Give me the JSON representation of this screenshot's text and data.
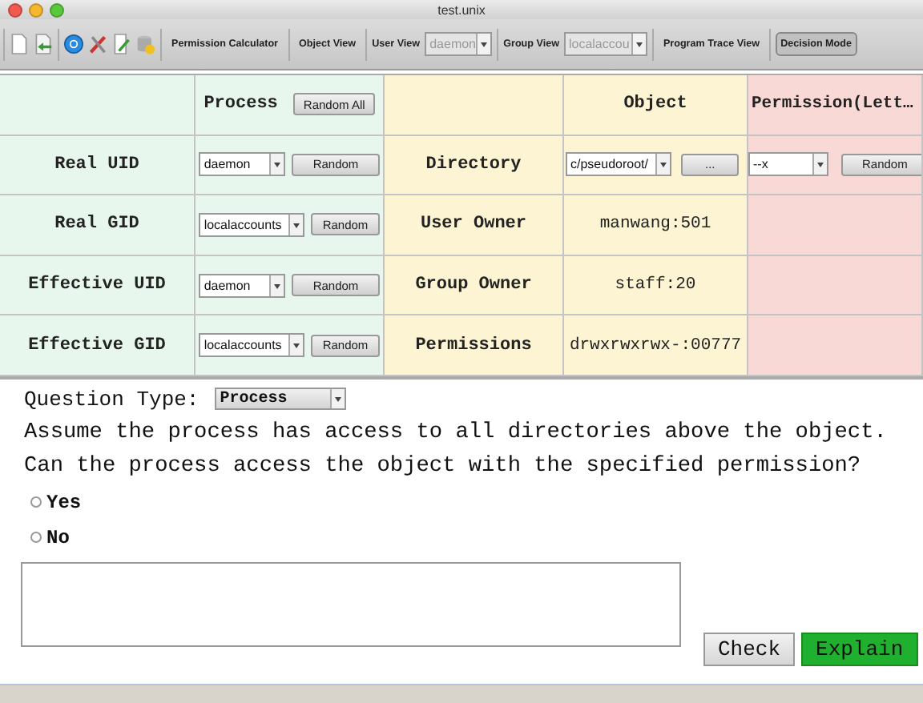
{
  "window": {
    "title": "test.unix"
  },
  "toolbar": {
    "views": [
      {
        "label": "Permission Calculator",
        "kind": "button",
        "selected": false
      },
      {
        "label": "Object View",
        "kind": "button",
        "selected": false
      },
      {
        "label": "User View",
        "kind": "combo",
        "value": "daemon",
        "disabled": true
      },
      {
        "label": "Group View",
        "kind": "combo",
        "value": "localaccou",
        "disabled": true
      },
      {
        "label": "Program Trace View",
        "kind": "button",
        "selected": false
      },
      {
        "label": "Decision Mode",
        "kind": "button",
        "selected": true
      }
    ]
  },
  "table": {
    "process_header": {
      "title": "Process",
      "button": "Random All"
    },
    "object_header": {
      "title": "Object"
    },
    "permission_header": {
      "title": "Permission(Lett…"
    },
    "process_rows": [
      {
        "label": "Real UID",
        "value": "daemon",
        "button": "Random"
      },
      {
        "label": "Real GID",
        "value": "localaccounts",
        "button": "Random"
      },
      {
        "label": "Effective UID",
        "value": "daemon",
        "button": "Random"
      },
      {
        "label": "Effective GID",
        "value": "localaccounts",
        "button": "Random"
      }
    ],
    "object_rows": [
      {
        "label": "Directory",
        "kind": "path",
        "value": "c/pseudoroot/",
        "button": "..."
      },
      {
        "label": "User Owner",
        "kind": "text",
        "value": "manwang:501"
      },
      {
        "label": "Group Owner",
        "kind": "text",
        "value": "staff:20"
      },
      {
        "label": "Permissions",
        "kind": "text",
        "value": "drwxrwxrwx-:00777"
      }
    ],
    "permission": {
      "value": "--x",
      "button": "Random"
    }
  },
  "question": {
    "label": "Question Type:",
    "type": "Process",
    "lines": [
      "Assume the process has access to all directories above the object.",
      "Can the process access the object with the specified permission?"
    ],
    "options": [
      {
        "label": "Yes",
        "selected": false
      },
      {
        "label": "No",
        "selected": false
      }
    ],
    "buttons": [
      {
        "label": "Check",
        "kind": "plain"
      },
      {
        "label": "Explain",
        "kind": "primary"
      }
    ]
  }
}
